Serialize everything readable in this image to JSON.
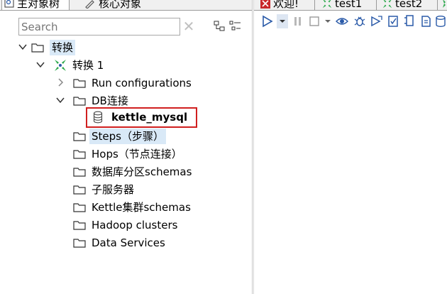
{
  "left_tabs": [
    {
      "label": "主对象树",
      "icon": "tree-icon",
      "active": true
    },
    {
      "label": "核心对象",
      "icon": "pencil-icon",
      "active": false
    }
  ],
  "search": {
    "placeholder": "Search",
    "value": "Search"
  },
  "tree": {
    "root": {
      "label": "转换",
      "icon": "folder-icon"
    },
    "transformation": {
      "label": "转换 1",
      "icon": "transformation-icon"
    },
    "run_configurations": {
      "label": "Run configurations"
    },
    "db_connections": {
      "label": "DB连接"
    },
    "db_item": {
      "label": "kettle_mysql",
      "icon": "database-icon"
    },
    "steps": {
      "label": "Steps（步骤）"
    },
    "hops": {
      "label": "Hops（节点连接）"
    },
    "partition_schemas": {
      "label": "数据库分区schemas"
    },
    "slave_servers": {
      "label": "子服务器"
    },
    "cluster_schemas": {
      "label": "Kettle集群schemas"
    },
    "hadoop_clusters": {
      "label": "Hadoop clusters"
    },
    "data_services": {
      "label": "Data Services"
    }
  },
  "right_tabs": [
    {
      "label": "欢迎!",
      "icon": "welcome-icon"
    },
    {
      "label": "test1",
      "icon": "transformation-icon"
    },
    {
      "label": "test2",
      "icon": "transformation-icon"
    }
  ],
  "colors": {
    "highlight_box": "#d01f1f",
    "selection": "#d9e9f7",
    "accent_green": "#2aa84a",
    "accent_blue": "#2a5aa8"
  }
}
